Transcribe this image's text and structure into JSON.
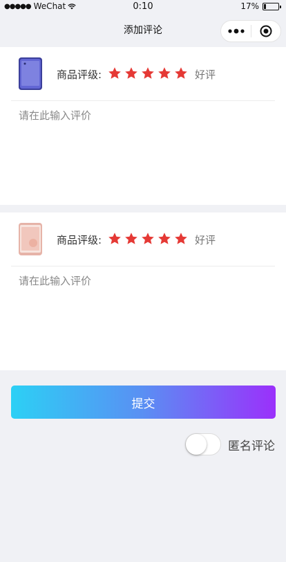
{
  "status_bar": {
    "carrier": "WeChat",
    "time": "0:10",
    "battery": "17%",
    "battery_level": 0.17
  },
  "nav": {
    "title": "添加评论"
  },
  "products": [
    {
      "rating_label": "商品评级:",
      "stars": 5,
      "rating_text": "好评",
      "review_placeholder": "请在此输入评价",
      "review_value": "",
      "thumb_color": "#5b5fc7"
    },
    {
      "rating_label": "商品评级:",
      "stars": 5,
      "rating_text": "好评",
      "review_placeholder": "请在此输入评价",
      "review_value": "",
      "thumb_color": "#f0c9c0"
    }
  ],
  "submit_label": "提交",
  "anonymous": {
    "label": "匿名评论",
    "enabled": false
  },
  "colors": {
    "star": "#e53935",
    "gradient_start": "#2cd0f5",
    "gradient_end": "#9b30fb",
    "background": "#f0f1f5"
  }
}
